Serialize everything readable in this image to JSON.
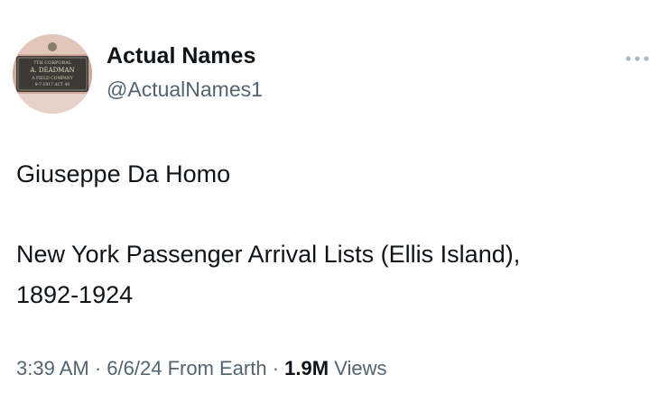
{
  "author": {
    "display_name": "Actual Names",
    "handle": "@ActualNames1",
    "avatar_plaque": {
      "line1": "7TH CORPORAL",
      "line2": "A. DEADMAN",
      "line3": "A FIELD COMPANY",
      "line4": "8-7-1917 ACT 40"
    }
  },
  "tweet": {
    "line1": "Giuseppe Da Homo",
    "line2": "New York Passenger Arrival Lists (Ellis Island),",
    "line3": "1892-1924"
  },
  "meta": {
    "time": "3:39 AM",
    "separator1": " · ",
    "date": "6/6/24",
    "source": " From Earth",
    "separator2": " · ",
    "views_count": "1.9M",
    "views_label": " Views"
  },
  "icons": {
    "more": "more-options-icon"
  },
  "colors": {
    "primary_text": "#0f1419",
    "secondary_text": "#536471",
    "background": "#ffffff",
    "more_icon": "#aab8c2"
  }
}
